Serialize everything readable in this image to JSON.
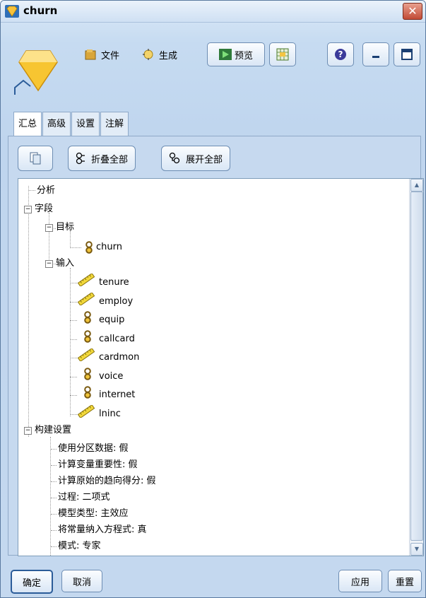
{
  "window": {
    "title": "churn"
  },
  "toolbar": {
    "file_label": "文件",
    "generate_label": "生成",
    "preview_label": "预览"
  },
  "tabs": [
    {
      "label": "汇总"
    },
    {
      "label": "高级"
    },
    {
      "label": "设置"
    },
    {
      "label": "注解"
    }
  ],
  "actions": {
    "collapse_all": "折叠全部",
    "expand_all": "展开全部"
  },
  "tree": {
    "analysis": "分析",
    "fields": "字段",
    "target": "目标",
    "target_fields": [
      {
        "name": "churn",
        "type": "flag"
      }
    ],
    "inputs": "输入",
    "input_fields": [
      {
        "name": "tenure",
        "type": "range"
      },
      {
        "name": "employ",
        "type": "range"
      },
      {
        "name": "equip",
        "type": "flag"
      },
      {
        "name": "callcard",
        "type": "flag"
      },
      {
        "name": "cardmon",
        "type": "range"
      },
      {
        "name": "voice",
        "type": "flag"
      },
      {
        "name": "internet",
        "type": "flag"
      },
      {
        "name": "lninc",
        "type": "range"
      }
    ],
    "build_settings": "构建设置",
    "settings": [
      "使用分区数据: 假",
      "计算变量重要性: 假",
      "计算原始的趋向得分: 假",
      "过程: 二项式",
      "模型类型: 主效应",
      "将常量纳入方程式: 真",
      "模式: 专家"
    ]
  },
  "buttons": {
    "ok": "确定",
    "cancel": "取消",
    "apply": "应用",
    "reset": "重置"
  },
  "colors": {
    "accent": "#2b5c99",
    "diamond": "#f2b31a"
  }
}
